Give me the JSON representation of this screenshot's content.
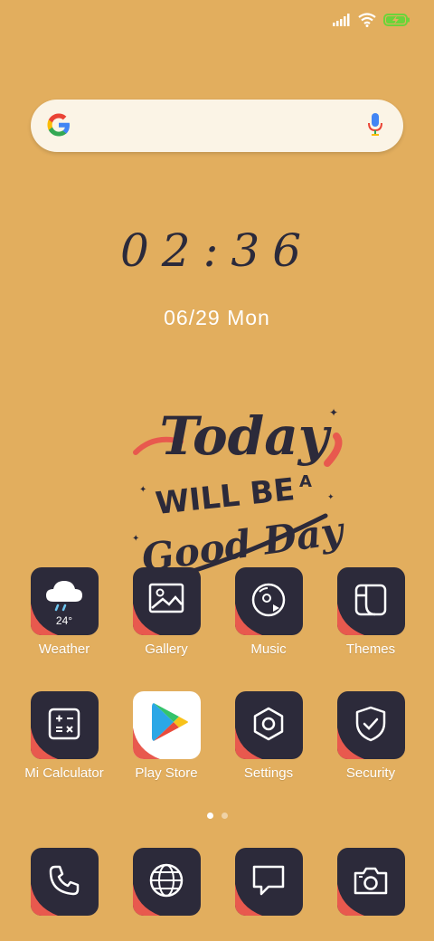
{
  "status_bar": {
    "icons": [
      "signal-icon",
      "wifi-icon",
      "battery-charging-icon"
    ],
    "battery_color": "#6BD43A"
  },
  "search": {
    "logo": "google-g-icon",
    "mic": "mic-icon"
  },
  "clock": {
    "time": "02:36"
  },
  "date": {
    "date_text": "06/29",
    "weekday": "Mon"
  },
  "wallpaper_art": {
    "line1": "Today",
    "line2": "WILL BE",
    "line3": "A",
    "line4": "Good Day"
  },
  "apps_row1": [
    {
      "label": "Weather",
      "icon": "cloud-rain-icon",
      "temp": "24°"
    },
    {
      "label": "Gallery",
      "icon": "image-icon"
    },
    {
      "label": "Music",
      "icon": "music-disc-icon"
    },
    {
      "label": "Themes",
      "icon": "themes-icon"
    }
  ],
  "apps_row2": [
    {
      "label": "Mi Calculator",
      "icon": "calculator-icon"
    },
    {
      "label": "Play Store",
      "icon": "play-store-icon"
    },
    {
      "label": "Settings",
      "icon": "hexagon-gear-icon"
    },
    {
      "label": "Security",
      "icon": "shield-check-icon"
    }
  ],
  "page_indicator": {
    "pages": 2,
    "current": 1
  },
  "dock": [
    {
      "icon": "phone-icon"
    },
    {
      "icon": "globe-icon"
    },
    {
      "icon": "message-icon"
    },
    {
      "icon": "camera-icon"
    }
  ],
  "colors": {
    "background": "#E2AE5E",
    "tile": "#2C2A3A",
    "accent_red": "#E8594E"
  }
}
